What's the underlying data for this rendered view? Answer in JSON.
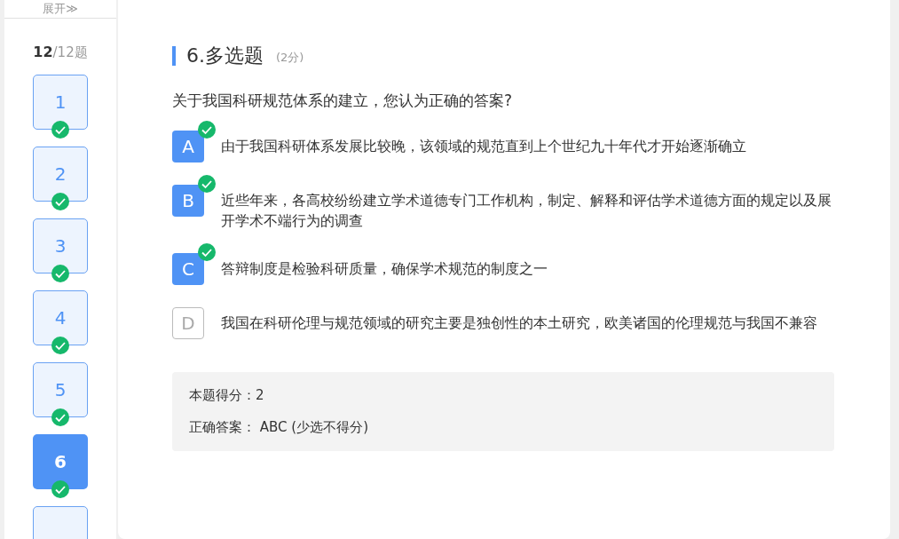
{
  "sidebar": {
    "expand_button": "展开≫",
    "progress": {
      "current": "12",
      "total": "/12题"
    },
    "items": [
      {
        "label": "1",
        "answered": true,
        "selected": false
      },
      {
        "label": "2",
        "answered": true,
        "selected": false
      },
      {
        "label": "3",
        "answered": true,
        "selected": false
      },
      {
        "label": "4",
        "answered": true,
        "selected": false
      },
      {
        "label": "5",
        "answered": true,
        "selected": false
      },
      {
        "label": "6",
        "answered": true,
        "selected": true
      },
      {
        "selected": false
      }
    ]
  },
  "question": {
    "title": "6.多选题",
    "points": "(2分)",
    "prompt": "关于我国科研规范体系的建立，您认为正确的答案?",
    "options": [
      {
        "letter": "A",
        "text": "由于我国科研体系发展比较晚，该领域的规范直到上个世纪九十年代才开始逐渐确立",
        "selected": true
      },
      {
        "letter": "B",
        "text": "近些年来，各高校纷纷建立学术道德专门工作机构，制定、解释和评估学术道德方面的规定以及展开学术不端行为的调查",
        "selected": true
      },
      {
        "letter": "C",
        "text": "答辩制度是检验科研质量，确保学术规范的制度之一",
        "selected": true
      },
      {
        "letter": "D",
        "text": "我国在科研伦理与规范领域的研究主要是独创性的本土研究，欧美诸国的伦理规范与我国不兼容",
        "selected": false
      }
    ],
    "result": {
      "score": "本题得分：2",
      "answer": "正确答案： ABC (少选不得分)"
    }
  }
}
